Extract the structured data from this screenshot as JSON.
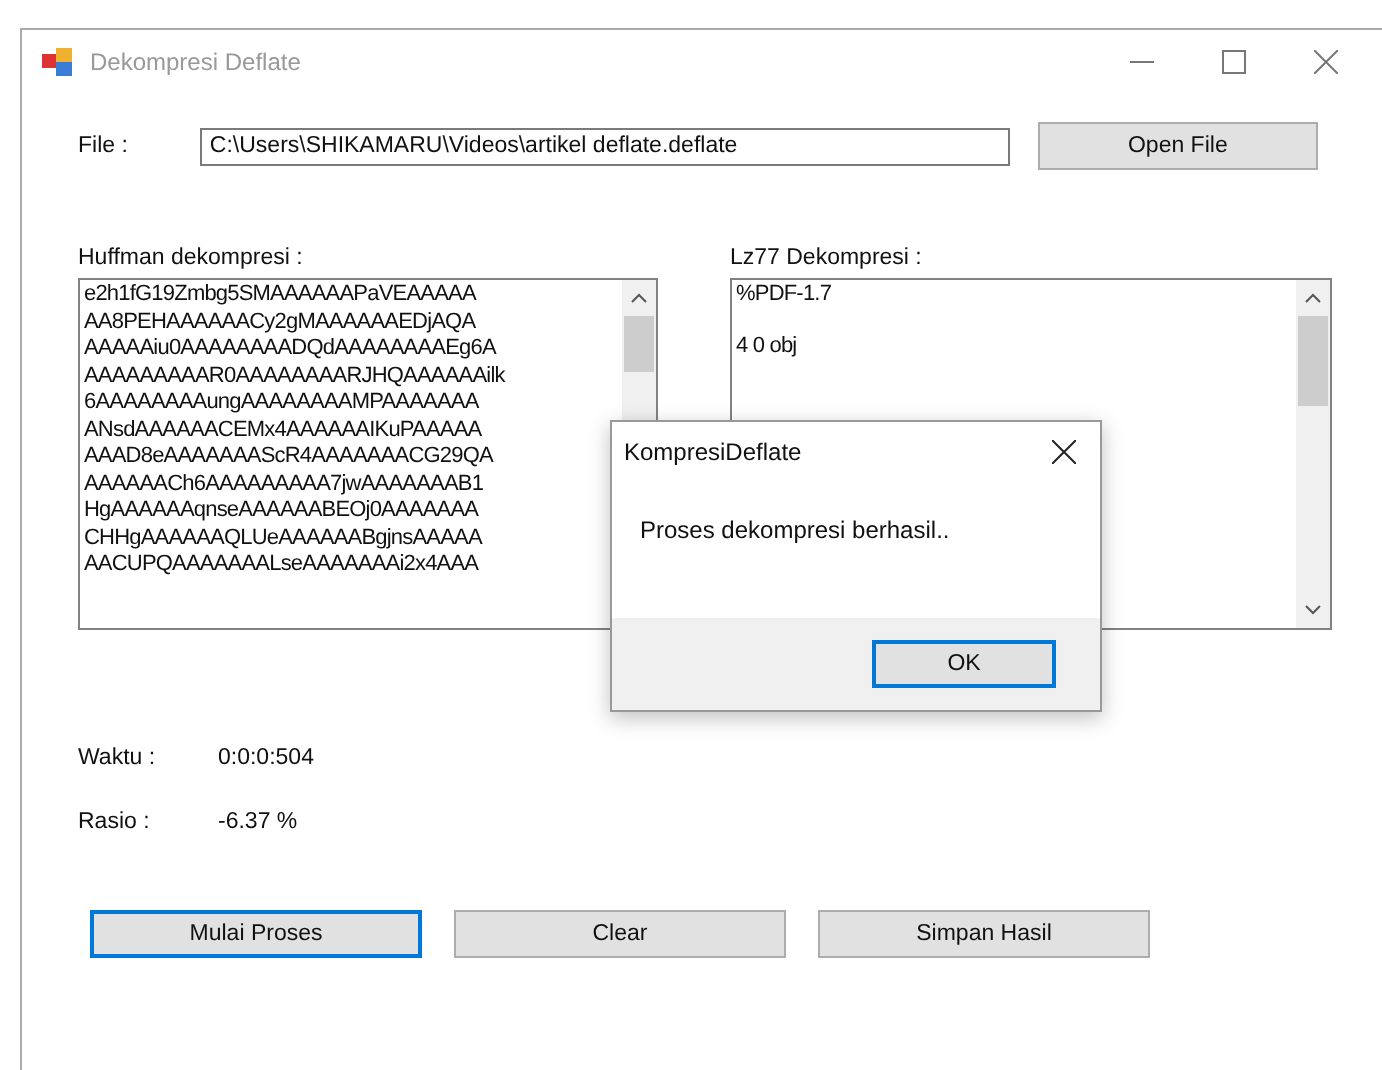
{
  "window": {
    "title": "Dekompresi Deflate",
    "active": false
  },
  "file": {
    "label": "File :",
    "value": "C:\\Users\\SHIKAMARU\\Videos\\artikel deflate.deflate",
    "button": "Open File"
  },
  "huffman": {
    "label": "Huffman dekompresi :",
    "lines": [
      "e2h1fG19Zmbg5SMAAAAAAPaVEAAAAA",
      "AA8PEHAAAAAACy2gMAAAAAAEDjAQA",
      "AAAAAiu0AAAAAAAADQdAAAAAAAAEg6A",
      "AAAAAAAAAR0AAAAAAAARJHQAAAAAAilk",
      "6AAAAAAAAungAAAAAAAAMPAAAAAAA",
      "ANsdAAAAAACEMx4AAAAAAIKuPAAAAA",
      "AAAD8eAAAAAAAScR4AAAAAAACG29QA",
      "AAAAAACh6AAAAAAAAA7jwAAAAAAAB1",
      "HgAAAAAAqnseAAAAAABEOj0AAAAAAA",
      "CHHgAAAAAAQLUeAAAAAABgjnsAAAAA",
      "AACUPQAAAAAAALseAAAAAAAi2x4AAA"
    ]
  },
  "lz77": {
    "label": "Lz77 Dekompresi :",
    "lines": [
      "%PDF-1.7",
      "4 0 obj"
    ]
  },
  "stats": [
    {
      "label": "Waktu :",
      "value": "0:0:0:504"
    },
    {
      "label": "Rasio :",
      "value": "-6.37 %"
    }
  ],
  "buttons": [
    {
      "label": "Mulai Proses",
      "focused": true
    },
    {
      "label": "Clear",
      "focused": false
    },
    {
      "label": "Simpan Hasil",
      "focused": false
    }
  ],
  "dialog": {
    "title": "KompresiDeflate",
    "message": "Proses dekompresi berhasil..",
    "button": {
      "label": "OK",
      "focused": true
    }
  }
}
